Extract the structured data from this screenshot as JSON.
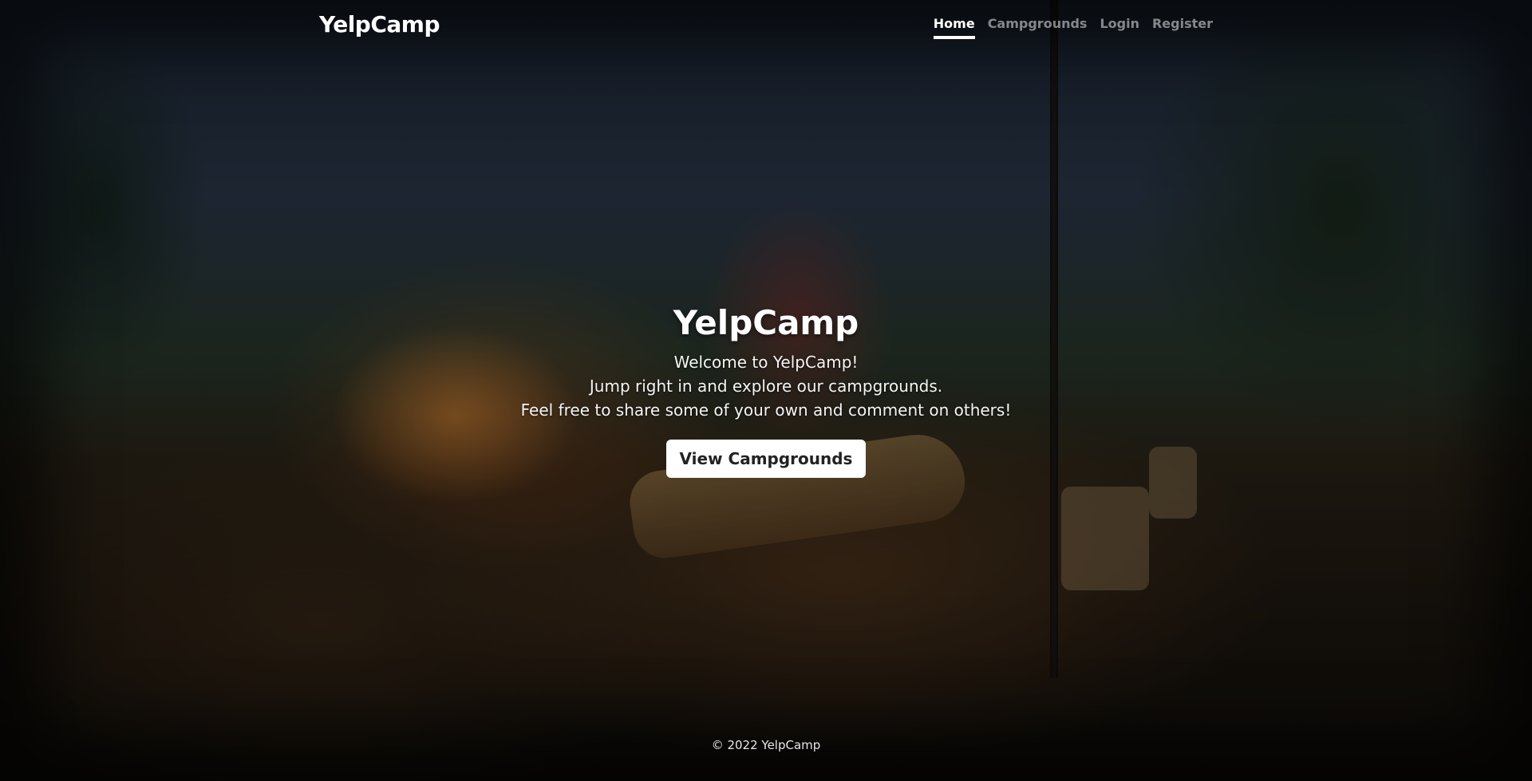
{
  "header": {
    "brand": "YelpCamp",
    "nav": [
      {
        "label": "Home",
        "active": true
      },
      {
        "label": "Campgrounds",
        "active": false
      },
      {
        "label": "Login",
        "active": false
      },
      {
        "label": "Register",
        "active": false
      }
    ]
  },
  "hero": {
    "title": "YelpCamp",
    "lines": [
      "Welcome to YelpCamp!",
      "Jump right in and explore our campgrounds.",
      "Feel free to share some of your own and comment on others!"
    ],
    "cta_label": "View Campgrounds"
  },
  "footer": {
    "text": "© 2022 YelpCamp"
  },
  "colors": {
    "text": "#ffffff",
    "nav_inactive": "rgba(255,255,255,0.5)",
    "button_bg": "#ffffff",
    "button_text": "#222222"
  }
}
